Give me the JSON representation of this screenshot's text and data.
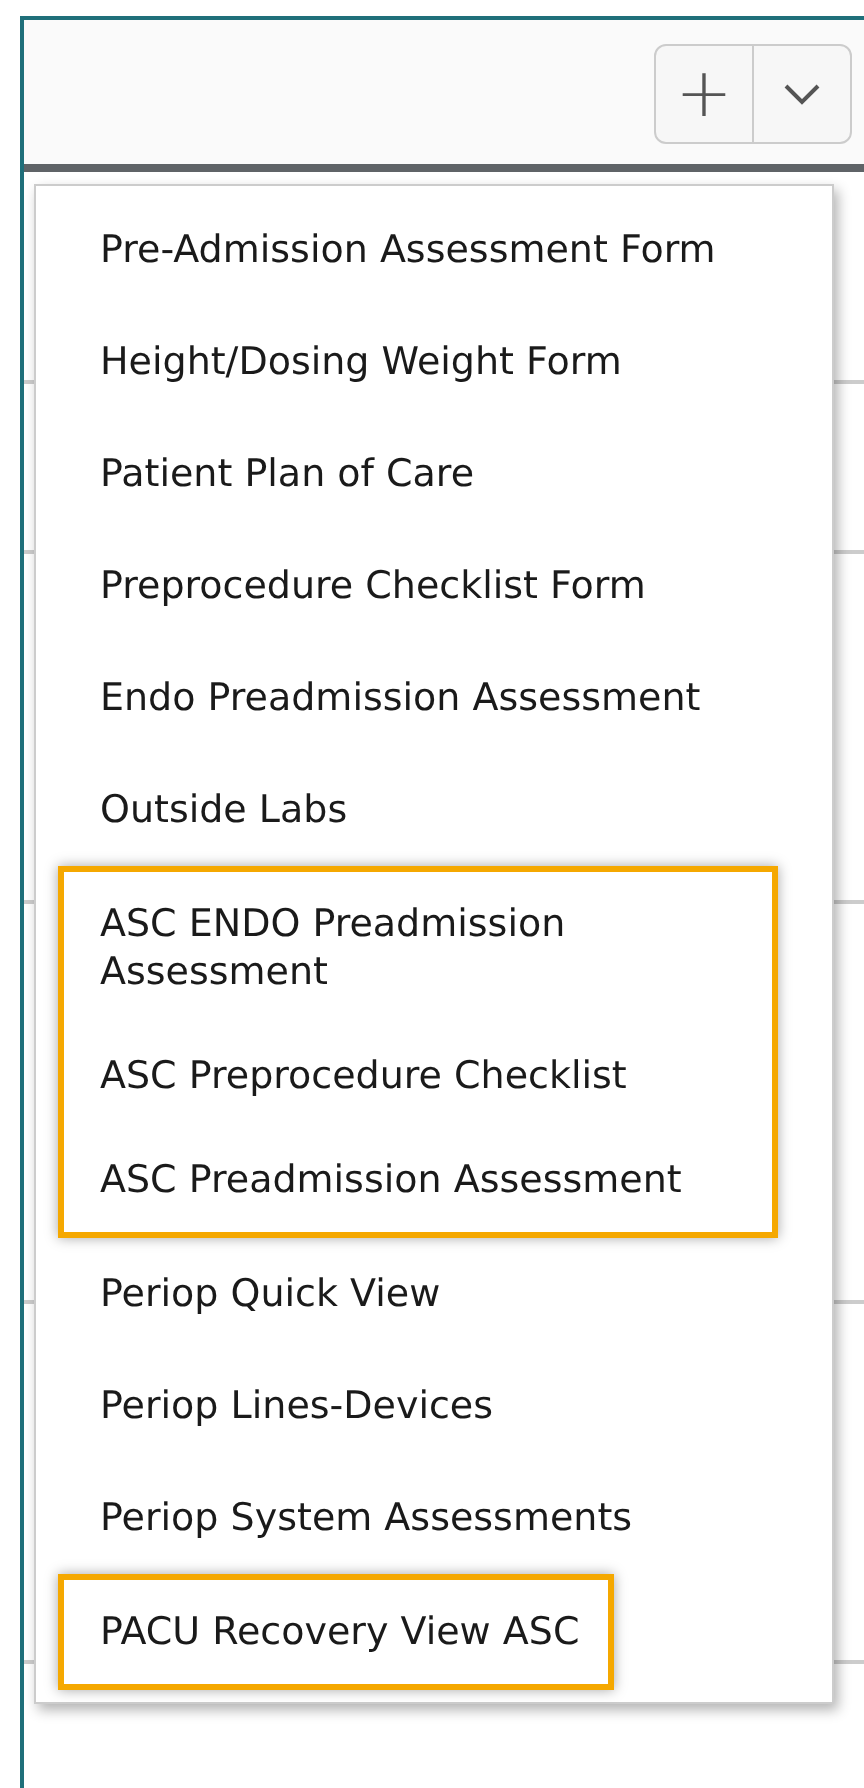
{
  "toolbar": {
    "add_button": "+"
  },
  "menu": {
    "sections": [
      {
        "highlighted": false,
        "items": [
          "Pre-Admission Assessment Form",
          "Height/Dosing Weight Form",
          "Patient Plan of Care",
          "Preprocedure Checklist Form",
          "Endo Preadmission Assessment",
          "Outside Labs"
        ]
      },
      {
        "highlighted": true,
        "items": [
          "ASC ENDO Preadmission Assessment",
          "ASC Preprocedure Checklist",
          "ASC Preadmission Assessment"
        ]
      },
      {
        "highlighted": false,
        "items": [
          "Periop Quick View",
          "Periop Lines-Devices",
          "Periop System Assessments"
        ]
      },
      {
        "highlighted": true,
        "items": [
          "PACU Recovery View ASC"
        ]
      }
    ]
  }
}
